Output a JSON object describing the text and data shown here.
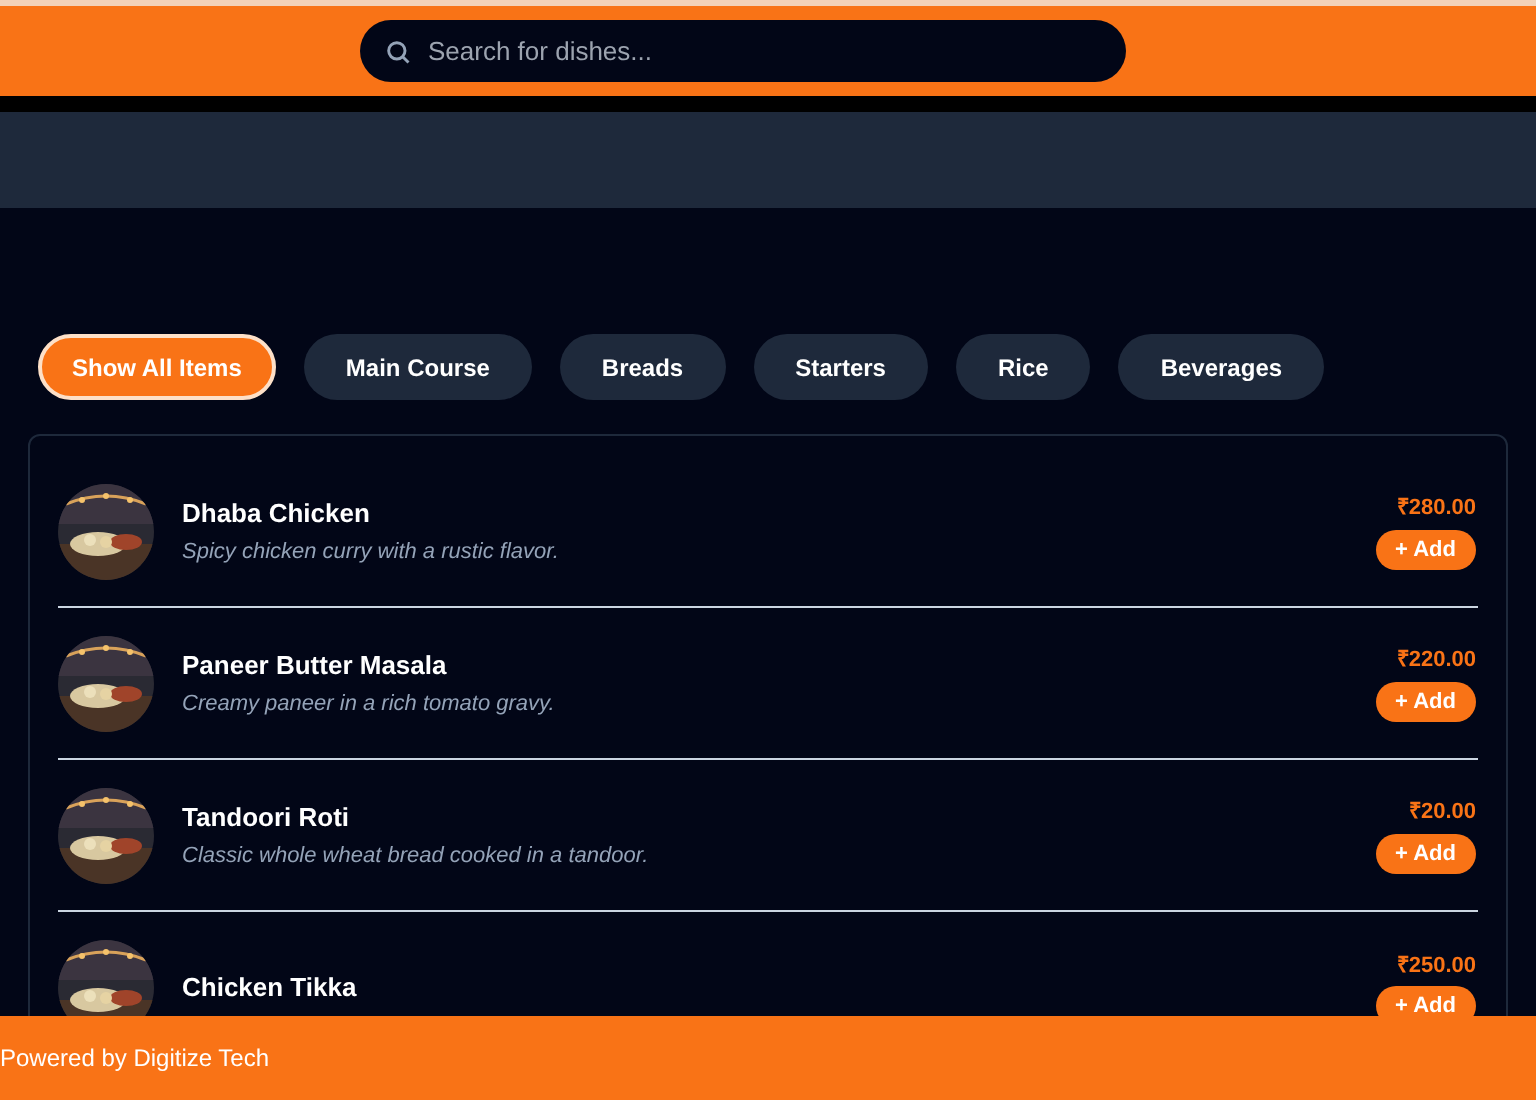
{
  "search": {
    "placeholder": "Search for dishes..."
  },
  "categories": [
    {
      "label": "Show All Items",
      "selected": true
    },
    {
      "label": "Main Course",
      "selected": false
    },
    {
      "label": "Breads",
      "selected": false
    },
    {
      "label": "Starters",
      "selected": false
    },
    {
      "label": "Rice",
      "selected": false
    },
    {
      "label": "Beverages",
      "selected": false
    }
  ],
  "items": [
    {
      "name": "Dhaba Chicken",
      "description": "Spicy chicken curry with a rustic flavor.",
      "price": "₹280.00",
      "button": "+ Add"
    },
    {
      "name": "Paneer Butter Masala",
      "description": "Creamy paneer in a rich tomato gravy.",
      "price": "₹220.00",
      "button": "+ Add"
    },
    {
      "name": "Tandoori Roti",
      "description": "Classic whole wheat bread cooked in a tandoor.",
      "price": "₹20.00",
      "button": "+ Add"
    },
    {
      "name": "Chicken Tikka",
      "price": "₹250.00",
      "button": "+ Add"
    }
  ],
  "footer": "Powered by Digitize Tech"
}
